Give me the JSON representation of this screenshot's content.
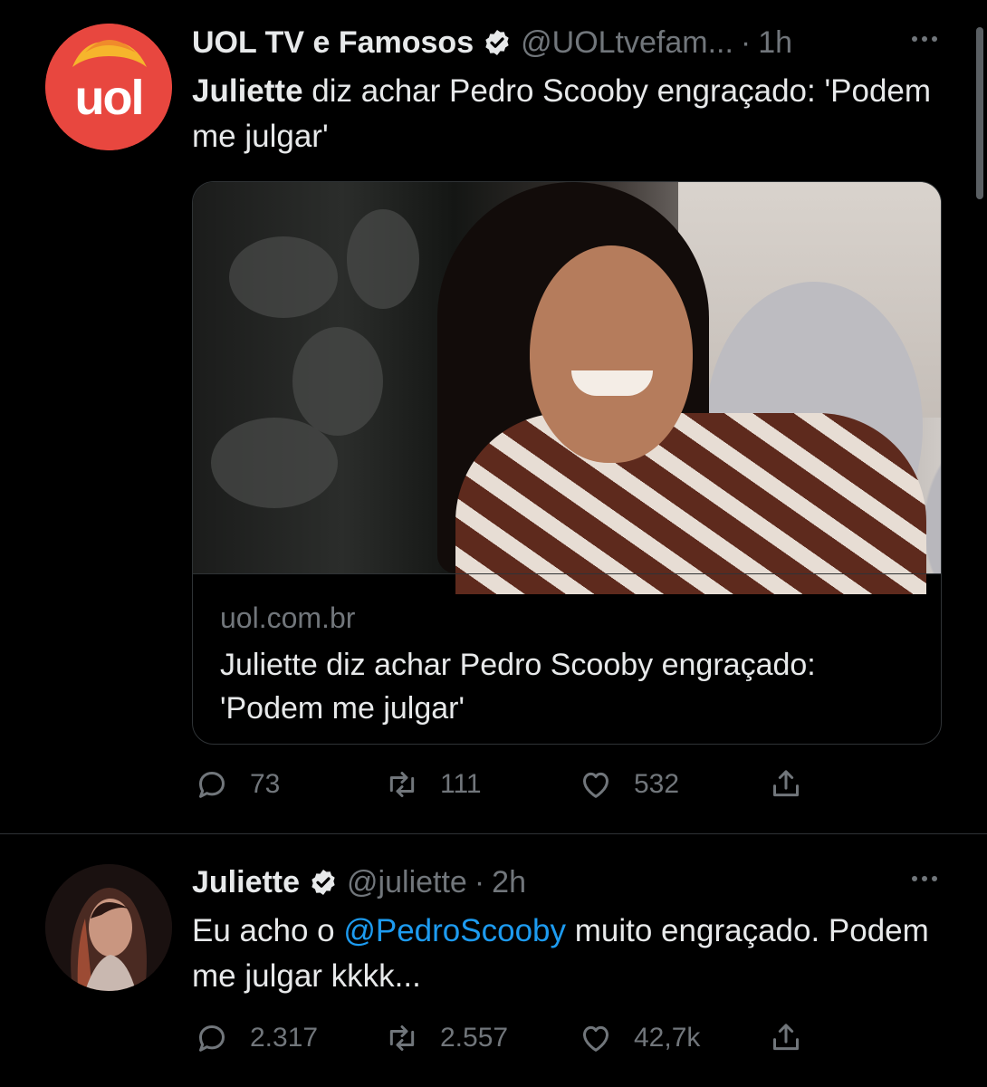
{
  "tweets": [
    {
      "name": "UOL TV e Famosos",
      "handle": "@UOLtvefam...",
      "separator": "·",
      "time": "1h",
      "avatar_logo": "uol",
      "text_bold": "Juliette",
      "text_rest": " diz achar Pedro Scooby engraçado: 'Podem me julgar'",
      "card": {
        "domain": "uol.com.br",
        "title": "Juliette diz achar Pedro Scooby engraçado: 'Podem me julgar'"
      },
      "replies": "73",
      "retweets": "111",
      "likes": "532"
    },
    {
      "name": "Juliette",
      "handle": "@juliette",
      "separator": "·",
      "time": "2h",
      "text_before": "Eu acho o ",
      "mention": "@PedroScooby",
      "text_after": " muito engraçado. Podem me julgar kkkk...",
      "replies": "2.317",
      "retweets": "2.557",
      "likes": "42,7k"
    }
  ],
  "colors": {
    "background": "#000000",
    "text": "#e7e9ea",
    "muted": "#71767b",
    "link": "#1d9bf0",
    "uol_red": "#e8473f"
  },
  "icons": [
    "verified-badge-icon",
    "more-icon",
    "reply-icon",
    "retweet-icon",
    "like-icon",
    "share-icon"
  ]
}
